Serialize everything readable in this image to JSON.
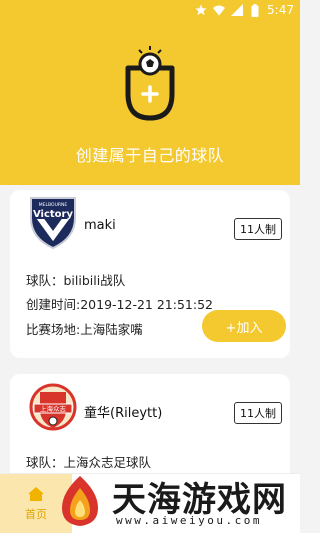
{
  "status_bar": {
    "time": "5:47",
    "icons": [
      "star-icon",
      "wifi-icon",
      "signal-icon",
      "battery-icon"
    ]
  },
  "hero": {
    "slogan": "创建属于自己的球队",
    "logo_icon": "shield-ball-plus-icon"
  },
  "teams": [
    {
      "name": "maki",
      "format": "11人制",
      "team_label": "球队：bilibili战队",
      "created_label": "创建时间:2019-12-21 21:51:52",
      "venue_label": "比赛场地:上海陆家嘴",
      "join_label": "+加入",
      "badge_text": "Victory",
      "badge_subtext": "MELBOURNE"
    },
    {
      "name": "童华(Rileytt)",
      "format": "11人制",
      "team_label": "球队：上海众志足球队",
      "badge_text": "上海众志"
    }
  ],
  "tabbar": {
    "home_label": "首页"
  },
  "watermark": {
    "title": "天海游戏网",
    "url": "www.aiweiyou.com"
  },
  "colors": {
    "accent": "#f4c82f",
    "navy": "#1c2a5c",
    "red": "#d9342b"
  }
}
